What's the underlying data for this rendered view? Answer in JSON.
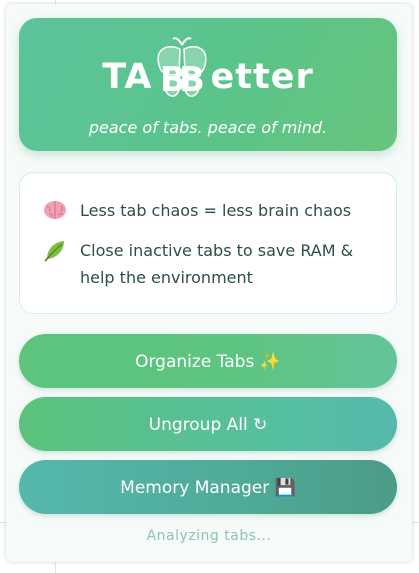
{
  "header": {
    "logo_left": "TA",
    "logo_right": "etter",
    "tagline": "peace of tabs. peace of mind."
  },
  "info": {
    "items": [
      {
        "icon": "brain-icon",
        "text": "Less tab chaos = less brain chaos"
      },
      {
        "icon": "leaf-icon",
        "text": "Close inactive tabs to save RAM & help the environment"
      }
    ]
  },
  "buttons": {
    "organize": "Organize Tabs ✨",
    "ungroup": "Ungroup All ↻",
    "memory": "Memory Manager 💾"
  },
  "status": "Analyzing tabs...",
  "colors": {
    "accent_green": "#5cc48a",
    "accent_teal": "#4faa98",
    "text_dark": "#2e4e4a",
    "status_text": "#8bc7ae"
  }
}
